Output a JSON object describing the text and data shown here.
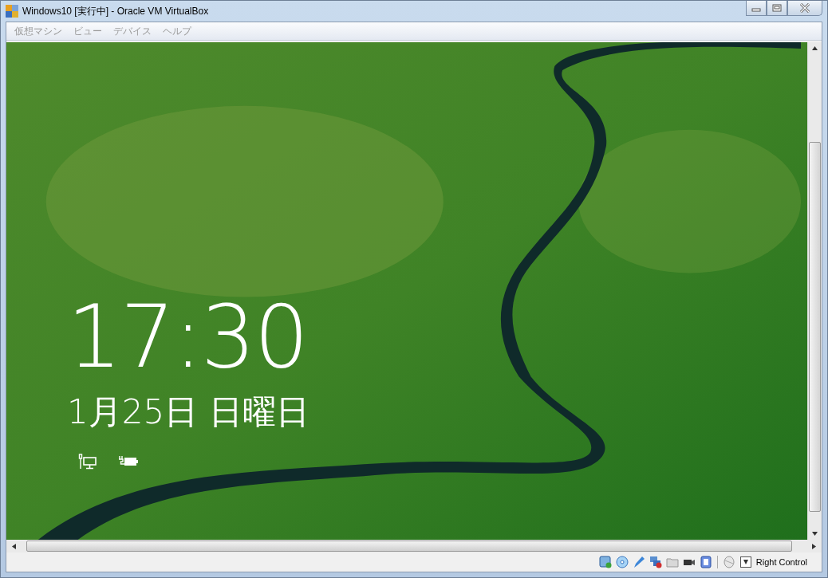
{
  "window": {
    "title": "Windows10 [実行中] - Oracle VM VirtualBox"
  },
  "menu": [
    {
      "label": "仮想マシン",
      "disabled": true
    },
    {
      "label": "ビュー",
      "disabled": true
    },
    {
      "label": "デバイス",
      "disabled": true
    },
    {
      "label": "ヘルプ",
      "disabled": true
    }
  ],
  "lock_screen": {
    "time": "17:30",
    "date": "1月25日 日曜日"
  },
  "status_bar": {
    "host_key": "Right Control"
  }
}
